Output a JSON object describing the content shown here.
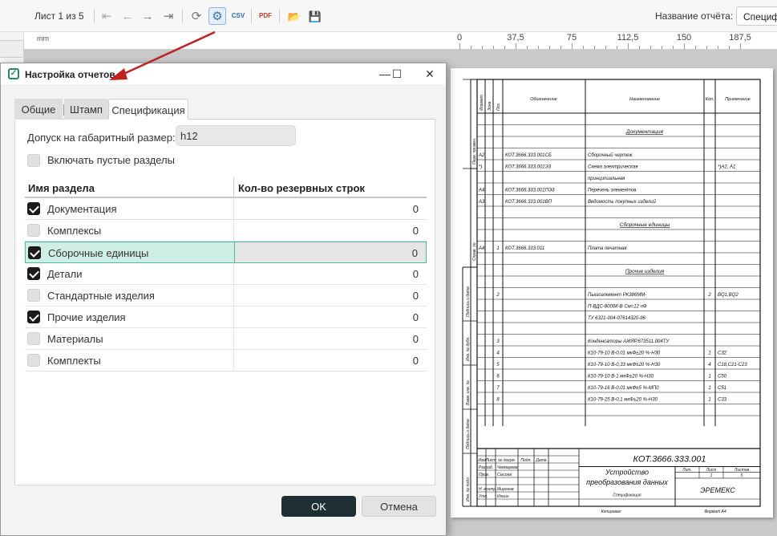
{
  "toolbar": {
    "page_indicator": "Лист 1 из 5",
    "first_icon": "⇤",
    "prev_icon": "←",
    "next_icon": "→",
    "last_icon": "⇥",
    "refresh_icon": "⟳",
    "settings_icon": "⚙",
    "csv_icon": "CSV",
    "pdf_icon": "PDF",
    "open_icon": "📂",
    "save_icon": "💾",
    "report_name_label": "Название отчёта:",
    "report_name_value": "Специфи"
  },
  "ruler": {
    "unit": "mm",
    "labels": [
      "0",
      "37,5",
      "75",
      "112,5",
      "150",
      "187,5"
    ]
  },
  "dialog": {
    "title": "Настройка отчетов",
    "minimize_icon": "—",
    "maximize_icon": "☐",
    "close_icon": "✕",
    "tabs": [
      {
        "label": "Общие",
        "active": false
      },
      {
        "label": "Штамп",
        "active": false
      },
      {
        "label": "Спецификация",
        "active": true
      }
    ],
    "tolerance_label": "Допуск на габаритный размер:",
    "tolerance_value": "h12",
    "include_empty_label": "Включать пустые разделы",
    "include_empty_checked": false,
    "grid_headers": {
      "name": "Имя раздела",
      "reserve": "Кол-во резервных строк"
    },
    "sections": [
      {
        "name": "Документация",
        "checked": true,
        "reserve": "0"
      },
      {
        "name": "Комплексы",
        "checked": false,
        "reserve": "0"
      },
      {
        "name": "Сборочные единицы",
        "checked": true,
        "reserve": "0",
        "selected": true
      },
      {
        "name": "Детали",
        "checked": true,
        "reserve": "0"
      },
      {
        "name": "Стандартные изделия",
        "checked": false,
        "reserve": "0"
      },
      {
        "name": "Прочие изделия",
        "checked": true,
        "reserve": "0"
      },
      {
        "name": "Материалы",
        "checked": false,
        "reserve": "0"
      },
      {
        "name": "Комплекты",
        "checked": false,
        "reserve": "0"
      }
    ],
    "ok_label": "OK",
    "cancel_label": "Отмена"
  },
  "sheet": {
    "side_labels": [
      "Перв. примен.",
      "Справ. №",
      "Подпись и дата",
      "Инв. № дубл.",
      "Взам. инв. №",
      "Подпись и дата",
      "Инв. № подл."
    ],
    "col_headers": [
      "Формат",
      "Зона",
      "Поз.",
      "Обозначение",
      "Наименование",
      "Кол.",
      "Примечание"
    ],
    "rows": [
      {
        "fmt": "",
        "zone": "",
        "pos": "",
        "code": "",
        "name": "",
        "qty": "",
        "note": ""
      },
      {
        "fmt": "",
        "zone": "",
        "pos": "",
        "code": "",
        "name": "Документация",
        "qty": "",
        "note": "",
        "heading": true
      },
      {
        "fmt": "",
        "zone": "",
        "pos": "",
        "code": "",
        "name": "",
        "qty": "",
        "note": ""
      },
      {
        "fmt": "А2",
        "zone": "",
        "pos": "",
        "code": "КОТ.3666.333.001СБ",
        "name": "Сборочный чертеж",
        "qty": "",
        "note": ""
      },
      {
        "fmt": "*)",
        "zone": "",
        "pos": "",
        "code": "КОТ.3666.333.001Э3",
        "name": "Схема электрическая",
        "qty": "",
        "note": "*)А2, А1"
      },
      {
        "fmt": "",
        "zone": "",
        "pos": "",
        "code": "",
        "name": "принципиальная",
        "qty": "",
        "note": ""
      },
      {
        "fmt": "А4",
        "zone": "",
        "pos": "",
        "code": "КОТ.3666.333.001ПЭ3",
        "name": "Перечень элементов",
        "qty": "",
        "note": ""
      },
      {
        "fmt": "А3",
        "zone": "",
        "pos": "",
        "code": "КОТ.3666.333.001ВП",
        "name": "Ведомость покупных изделий",
        "qty": "",
        "note": ""
      },
      {
        "fmt": "",
        "zone": "",
        "pos": "",
        "code": "",
        "name": "",
        "qty": "",
        "note": ""
      },
      {
        "fmt": "",
        "zone": "",
        "pos": "",
        "code": "",
        "name": "Сборочные единицы",
        "qty": "",
        "note": "",
        "heading": true
      },
      {
        "fmt": "",
        "zone": "",
        "pos": "",
        "code": "",
        "name": "",
        "qty": "",
        "note": ""
      },
      {
        "fmt": "А4",
        "zone": "",
        "pos": "1",
        "code": "КОТ.3666.333.011",
        "name": "Плата печатная",
        "qty": "",
        "note": ""
      },
      {
        "fmt": "",
        "zone": "",
        "pos": "",
        "code": "",
        "name": "",
        "qty": "",
        "note": ""
      },
      {
        "fmt": "",
        "zone": "",
        "pos": "",
        "code": "",
        "name": "Прочие изделия",
        "qty": "",
        "note": "",
        "heading": true
      },
      {
        "fmt": "",
        "zone": "",
        "pos": "",
        "code": "",
        "name": "",
        "qty": "",
        "note": ""
      },
      {
        "fmt": "",
        "zone": "",
        "pos": "2",
        "code": "",
        "name": "Пьезоэлемент РК386ММ-",
        "qty": "2",
        "note": "BQ1,BQ2"
      },
      {
        "fmt": "",
        "zone": "",
        "pos": "",
        "code": "",
        "name": "П-ВДС-8000К-В См=12 пФ",
        "qty": "",
        "note": ""
      },
      {
        "fmt": "",
        "zone": "",
        "pos": "",
        "code": "",
        "name": "ТУ 6321-004-07614320-96",
        "qty": "",
        "note": ""
      },
      {
        "fmt": "",
        "zone": "",
        "pos": "",
        "code": "",
        "name": "",
        "qty": "",
        "note": ""
      },
      {
        "fmt": "",
        "zone": "",
        "pos": "3",
        "code": "",
        "name": "Конденсаторы АЖЯР.673511.004ТУ",
        "qty": "",
        "note": ""
      },
      {
        "fmt": "",
        "zone": "",
        "pos": "4",
        "code": "",
        "name": "К10-79-10 В-0,01 мкФ±20 %-Н30",
        "qty": "1",
        "note": "С32"
      },
      {
        "fmt": "",
        "zone": "",
        "pos": "5",
        "code": "",
        "name": "К10-79-10 В-0,33 мкФ±20 %-Н30",
        "qty": "4",
        "note": "С18,С21-С23"
      },
      {
        "fmt": "",
        "zone": "",
        "pos": "6",
        "code": "",
        "name": "К10-79-10 В-1 мкФ±20 %-Н30",
        "qty": "1",
        "note": "С50"
      },
      {
        "fmt": "",
        "zone": "",
        "pos": "7",
        "code": "",
        "name": "К10-79-16 В-0,01 мкФ±5 %-МП0",
        "qty": "1",
        "note": "С51"
      },
      {
        "fmt": "",
        "zone": "",
        "pos": "8",
        "code": "",
        "name": "К10-79-25 В-0,1 мкФ±20 %-Н30",
        "qty": "1",
        "note": "С33"
      },
      {
        "fmt": "",
        "zone": "",
        "pos": "",
        "code": "",
        "name": "",
        "qty": "",
        "note": ""
      },
      {
        "fmt": "",
        "zone": "",
        "pos": "",
        "code": "",
        "name": "",
        "qty": "",
        "note": ""
      },
      {
        "fmt": "",
        "zone": "",
        "pos": "",
        "code": "",
        "name": "",
        "qty": "",
        "note": ""
      }
    ],
    "stamp": {
      "designation": "КОТ.3666.333.001",
      "title_line1": "Устройство",
      "title_line2": "преобразования данных",
      "company": "ЭРЕМЕКС",
      "doc_type": "Спецификация",
      "col_labels": [
        "Изм",
        "Лист",
        "№ докум.",
        "Подп.",
        "Дата"
      ],
      "roles": [
        {
          "role": "Разраб.",
          "person": "Чекмарева"
        },
        {
          "role": "Пров.",
          "person": "Сысоев"
        },
        {
          "role": "",
          "person": ""
        },
        {
          "role": "Н. контр.",
          "person": "Миронов"
        },
        {
          "role": "Утв.",
          "person": "Ильин"
        }
      ],
      "lit_label": "Лит.",
      "sheet_label": "Лист",
      "sheets_label": "Листов",
      "sheet_value": "1",
      "sheets_value": "5",
      "copied": "Копировал",
      "format": "Формат А4"
    }
  }
}
